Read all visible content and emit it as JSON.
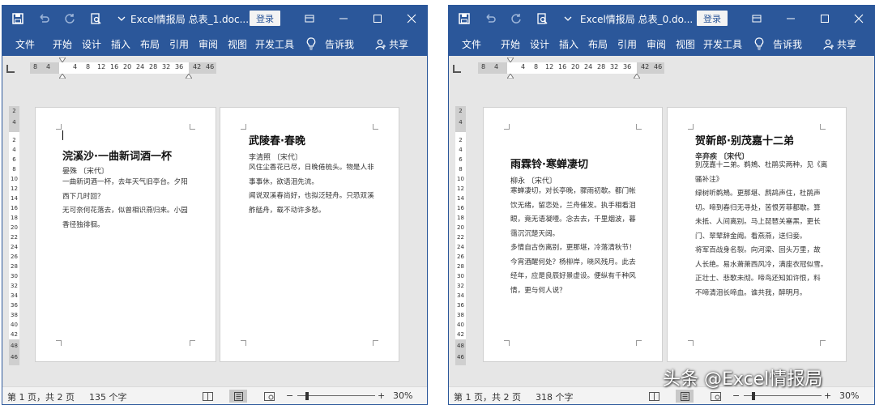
{
  "colors": {
    "ribbon": "#2b579a",
    "canvas": "#e6e6e6",
    "statusbar": "#f3f3f3"
  },
  "login_label": "登录",
  "menu": {
    "file": "文件",
    "home": "开始",
    "design": "设计",
    "insert": "插入",
    "layout": "布局",
    "references": "引用",
    "review": "审阅",
    "view": "视图",
    "developer": "开发工具",
    "tellme": "告诉我",
    "share": "共享"
  },
  "icons": {
    "save": "save-icon",
    "undo": "undo-icon",
    "redo": "redo-icon",
    "print_preview": "print-preview-icon",
    "qat_more": "chevron-down-icon",
    "ribbon_display": "ribbon-display-icon",
    "minimize": "minimize-icon",
    "maximize": "maximize-icon",
    "close": "close-icon",
    "lightbulb": "lightbulb-icon",
    "share": "person-icon"
  },
  "ruler": {
    "left_labels": [
      "8",
      "4",
      "4",
      "8",
      "12",
      "16",
      "20",
      "24",
      "28",
      "32",
      "36",
      "42",
      "46"
    ],
    "right_labels": [
      "8",
      "4",
      "4",
      "8",
      "12",
      "16",
      "20",
      "24",
      "28",
      "32",
      "36",
      "42",
      "46"
    ],
    "vertical_labels": [
      "2",
      "4",
      "2",
      "4",
      "6",
      "8",
      "10",
      "12",
      "14",
      "16",
      "18",
      "20",
      "22",
      "24",
      "26",
      "28",
      "30",
      "32",
      "34",
      "36",
      "38",
      "40",
      "42",
      "48",
      "46"
    ]
  },
  "left_window": {
    "title": "Excel情报局 总表_1.doc...",
    "status": {
      "page": "第 1 页，共 2 页",
      "words": "135 个字",
      "zoom": "30%",
      "zoom_minus": "−",
      "zoom_plus": "+"
    },
    "pages": [
      {
        "title": "浣溪沙·一曲新词酒一杯",
        "author": "晏殊 〔宋代〕",
        "lines": [
          "一曲新词酒一杯，去年天气旧亭台。夕阳",
          "西下几时回？",
          "无可奈何花落去，似曾相识燕归来。小园",
          "香径独徘徊。"
        ]
      },
      {
        "title": "武陵春·春晚",
        "author": "李清照 〔宋代〕",
        "lines": [
          "风住尘香花已尽，日晚倦梳头。物是人非",
          "事事休，欲语泪先流。",
          "闻说双溪春尚好，也拟泛轻舟。只恐双溪",
          "舴艋舟，载不动许多愁。"
        ]
      }
    ]
  },
  "right_window": {
    "title": "Excel情报局 总表_0.do...",
    "status": {
      "page": "第 1 页，共 2 页",
      "words": "318 个字",
      "zoom": "30%",
      "zoom_minus": "−",
      "zoom_plus": "+"
    },
    "pages": [
      {
        "title": "雨霖铃·寒蝉凄切",
        "author": "柳永 〔宋代〕",
        "lines": [
          "寒蝉凄切，对长亭晚，骤雨初歇。都门帐",
          "饮无绪，留恋处，兰舟催发。执手相看泪",
          "眼，竟无语凝噎。念去去，千里烟波，暮",
          "霭沉沉楚天阔。",
          "多情自古伤离别，更那堪，冷落清秋节！",
          "今宵酒醒何处？杨柳岸，晓风残月。此去",
          "经年，应是良辰好景虚设。便纵有千种风",
          "情，更与何人说？"
        ]
      },
      {
        "title": "贺新郎·别茂嘉十二弟",
        "author": "辛弃疾 〔宋代〕",
        "lines": [
          "别茂嘉十二弟。鹈鴂、杜鹃实两种，见《离",
          "骚补注》",
          "绿树听鹈鴂。更那堪、鹧鸪声住，杜鹃声",
          "切。啼到春归无寻处，苦恨芳菲都歇。算",
          "未抵、人间离别。马上琵琶关塞黑，更长",
          "门、翠辇辞金阙。看燕燕，送归妾。",
          "将军百战身名裂。向河梁、回头万里，故",
          "人长绝。易水萧萧西风冷，满座衣冠似雪。",
          "正壮士、悲歌未彻。啼鸟还知如许恨，料",
          "不啼清泪长啼血。谁共我，醉明月。"
        ]
      }
    ]
  },
  "watermark": "头条 @Excel情报局"
}
